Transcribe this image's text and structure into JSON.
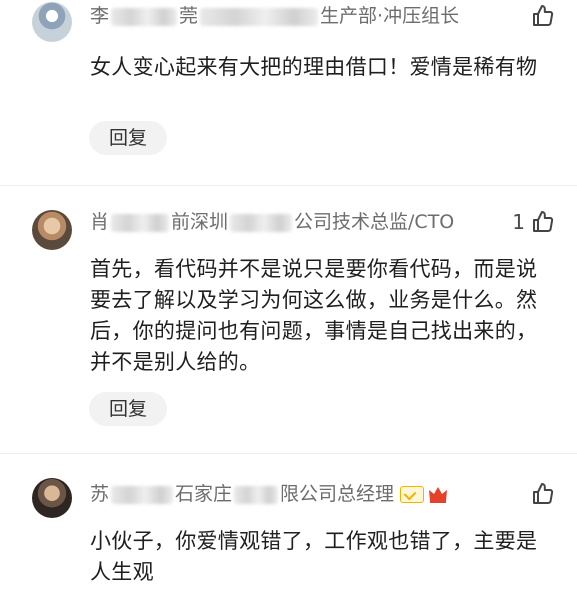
{
  "comments": [
    {
      "name_visible": "李",
      "meta_visible_1": "莞",
      "meta_visible_2": "生产部·冲压组长",
      "like_count": "",
      "text": "女人变心起来有大把的理由借口！爱情是稀有物",
      "reply_label": "回复"
    },
    {
      "name_visible": "肖",
      "meta_visible_1": "前深圳",
      "meta_visible_2": "公司技术总监/CTO",
      "like_count": "1",
      "text": "首先，看代码并不是说只是要你看代码，而是说要去了解以及学习为何这么做，业务是什么。然后，你的提问也有问题，事情是自己找出来的，并不是别人给的。",
      "reply_label": "回复"
    },
    {
      "name_visible": "苏",
      "meta_visible_1": "石家庄",
      "meta_visible_2": "限公司总经理",
      "like_count": "",
      "text": "小伙子，你爱情观错了，工作观也错了，主要是人生观"
    }
  ],
  "icons": {
    "like": "thumbs-up-icon",
    "verified": "verified-badge-icon",
    "crown": "crown-icon"
  },
  "colors": {
    "accent_badge": "#f0b400",
    "crown": "#e5402a"
  }
}
